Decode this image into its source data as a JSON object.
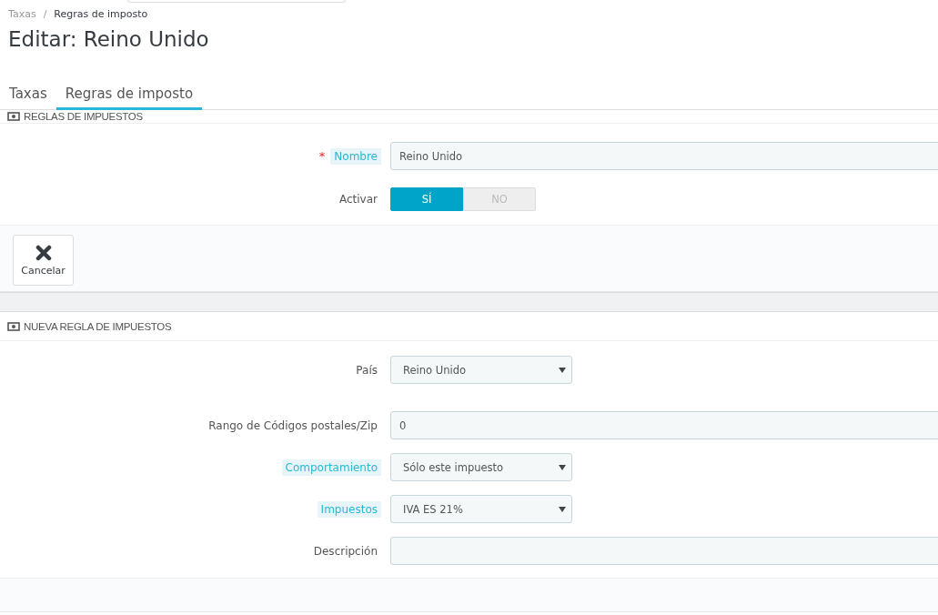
{
  "breadcrumb": {
    "separator": "/",
    "items": [
      {
        "label": "Taxas",
        "selected": false
      },
      {
        "label": "Regras de imposto",
        "selected": true
      }
    ]
  },
  "title": "Editar: Reino Unido",
  "tabs": [
    {
      "label": "Taxas",
      "selected": false
    },
    {
      "label": "Regras de imposto",
      "selected": true
    }
  ],
  "rule_panel": {
    "heading": "REGLAS DE IMPUESTOS",
    "fields": [
      {
        "kind": "text",
        "label": "Nombre",
        "required_mark": "*",
        "hint": true,
        "value": "Reino Unido"
      },
      {
        "kind": "toggle",
        "label": "Activar",
        "hint": false,
        "options": [
          {
            "label": "SÍ",
            "selected": true
          },
          {
            "label": "NO",
            "selected": false
          }
        ]
      }
    ],
    "buttons": [
      {
        "label": "Cancelar"
      }
    ]
  },
  "new_rule_panel": {
    "heading": "NUEVA REGLA DE IMPUESTOS",
    "fields": [
      {
        "kind": "select",
        "label": "País",
        "hint": false,
        "value": "Reino Unido"
      },
      {
        "kind": "text",
        "label": "Rango de Códigos postales/Zip",
        "hint": false,
        "value": "0"
      },
      {
        "kind": "select",
        "label": "Comportamiento",
        "hint": true,
        "value": "Sólo este impuesto"
      },
      {
        "kind": "select",
        "label": "Impuestos",
        "hint": true,
        "value": "IVA ES 21%"
      },
      {
        "kind": "text",
        "label": "Descripción",
        "hint": false
      }
    ]
  }
}
